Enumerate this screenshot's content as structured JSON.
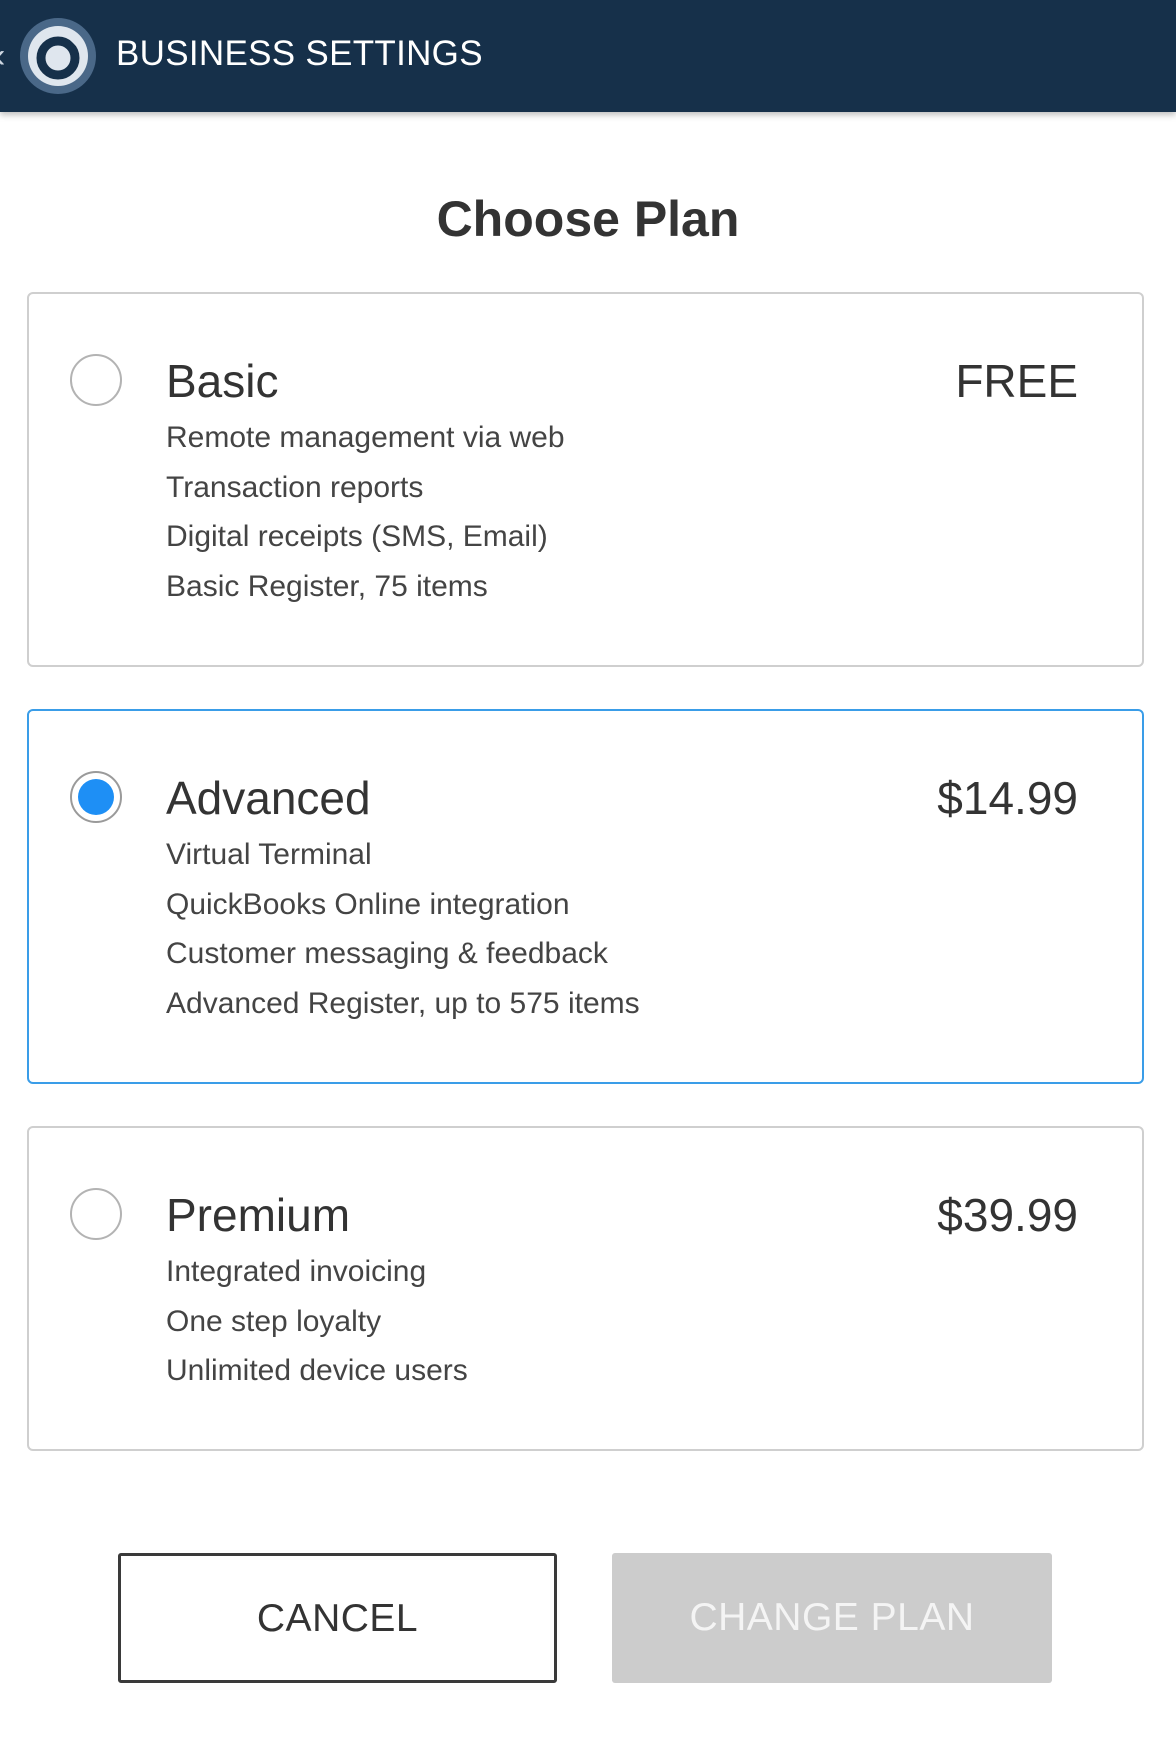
{
  "header": {
    "title": "BUSINESS SETTINGS",
    "back_icon": "chevron-left-icon",
    "logo_icon": "app-logo-icon",
    "background_color": "#16304a"
  },
  "page": {
    "title": "Choose Plan"
  },
  "plans": [
    {
      "name": "Basic",
      "price": "FREE",
      "selected": false,
      "features": [
        "Remote management via web",
        "Transaction reports",
        "Digital receipts (SMS, Email)",
        "Basic Register, 75 items"
      ]
    },
    {
      "name": "Advanced",
      "price": "$14.99",
      "selected": true,
      "features": [
        "Virtual Terminal",
        "QuickBooks Online integration",
        "Customer messaging & feedback",
        "Advanced Register, up to 575 items"
      ]
    },
    {
      "name": "Premium",
      "price": "$39.99",
      "selected": false,
      "features": [
        "Integrated invoicing",
        "One step loyalty",
        "Unlimited device users"
      ]
    }
  ],
  "actions": {
    "cancel_label": "CANCEL",
    "change_plan_label": "CHANGE PLAN",
    "change_plan_enabled": false
  },
  "colors": {
    "accent": "#1e8ff5",
    "selected_border": "#3a9de8",
    "disabled_button": "#cccccc"
  }
}
